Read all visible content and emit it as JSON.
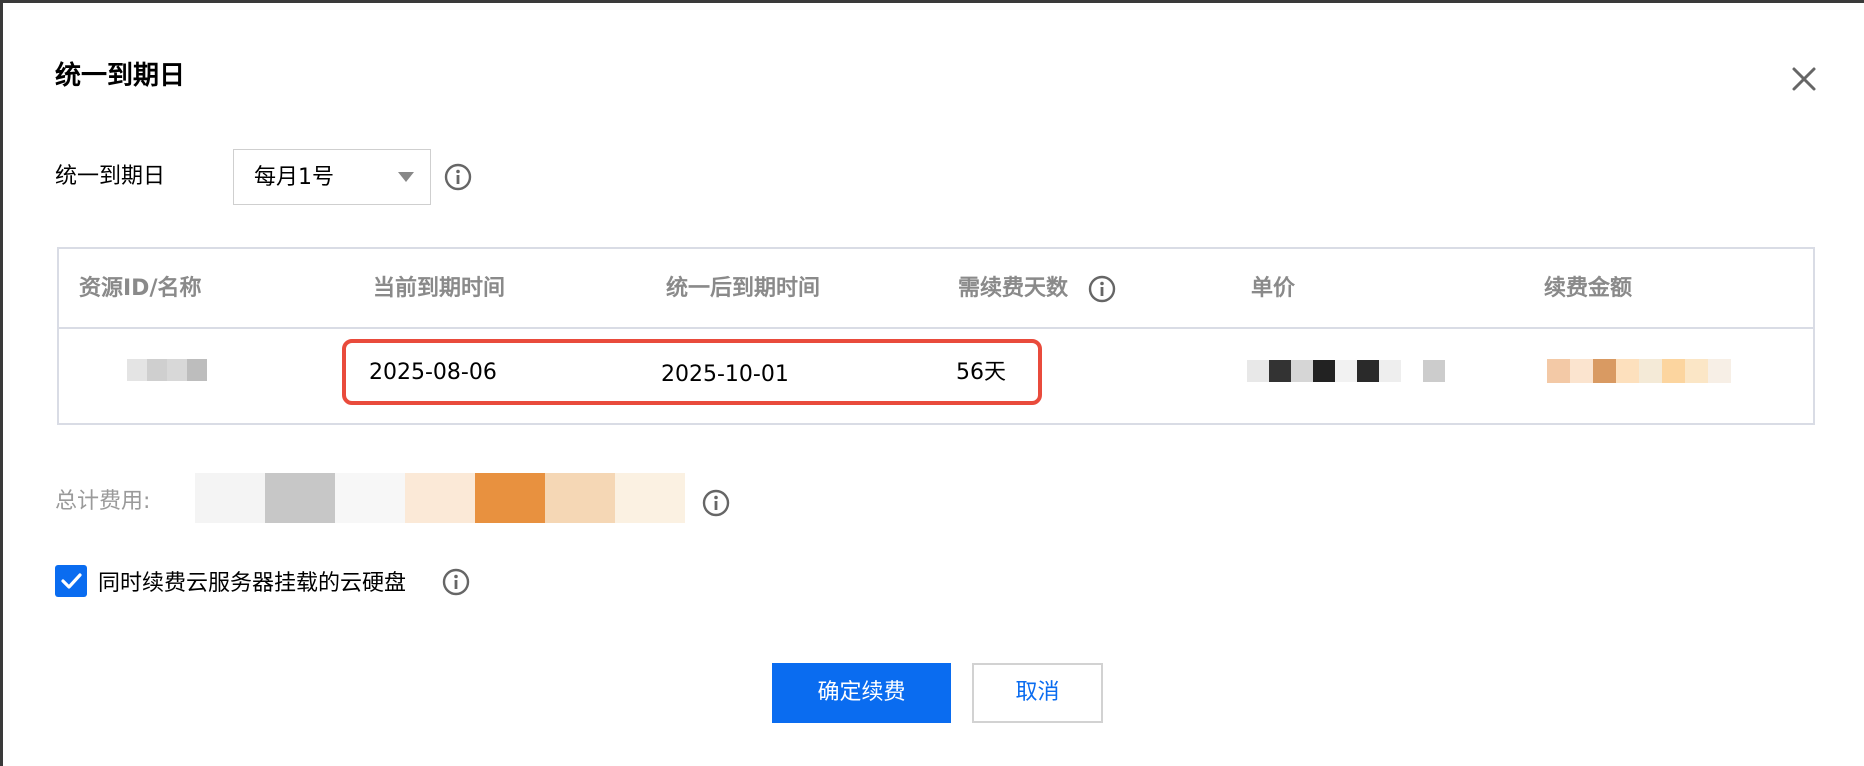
{
  "dialog": {
    "title": "统一到期日"
  },
  "expiry_setting": {
    "label": "统一到期日",
    "selected": "每月1号"
  },
  "table": {
    "columns": [
      "资源ID/名称",
      "当前到期时间",
      "统一后到期时间",
      "需续费天数",
      "单价",
      "续费金额"
    ],
    "rows": [
      {
        "current_expiry": "2025-08-06",
        "new_expiry": "2025-10-01",
        "renew_days": "56天"
      }
    ]
  },
  "summary": {
    "total_label": "总计费用:"
  },
  "disk_option": {
    "label": "同时续费云服务器挂载的云硬盘",
    "checked": true
  },
  "actions": {
    "confirm_label": "确定续费",
    "cancel_label": "取消"
  },
  "colors": {
    "primary": "#0a6cf0",
    "highlight_border": "#e94b3c",
    "table_border": "#d9dce5",
    "header_text": "#8a8a8a",
    "muted_text": "#9a9a9a"
  },
  "icons": {
    "close": "close-icon",
    "info": "info-icon",
    "dropdown": "caret-down-icon",
    "check": "check-icon"
  }
}
